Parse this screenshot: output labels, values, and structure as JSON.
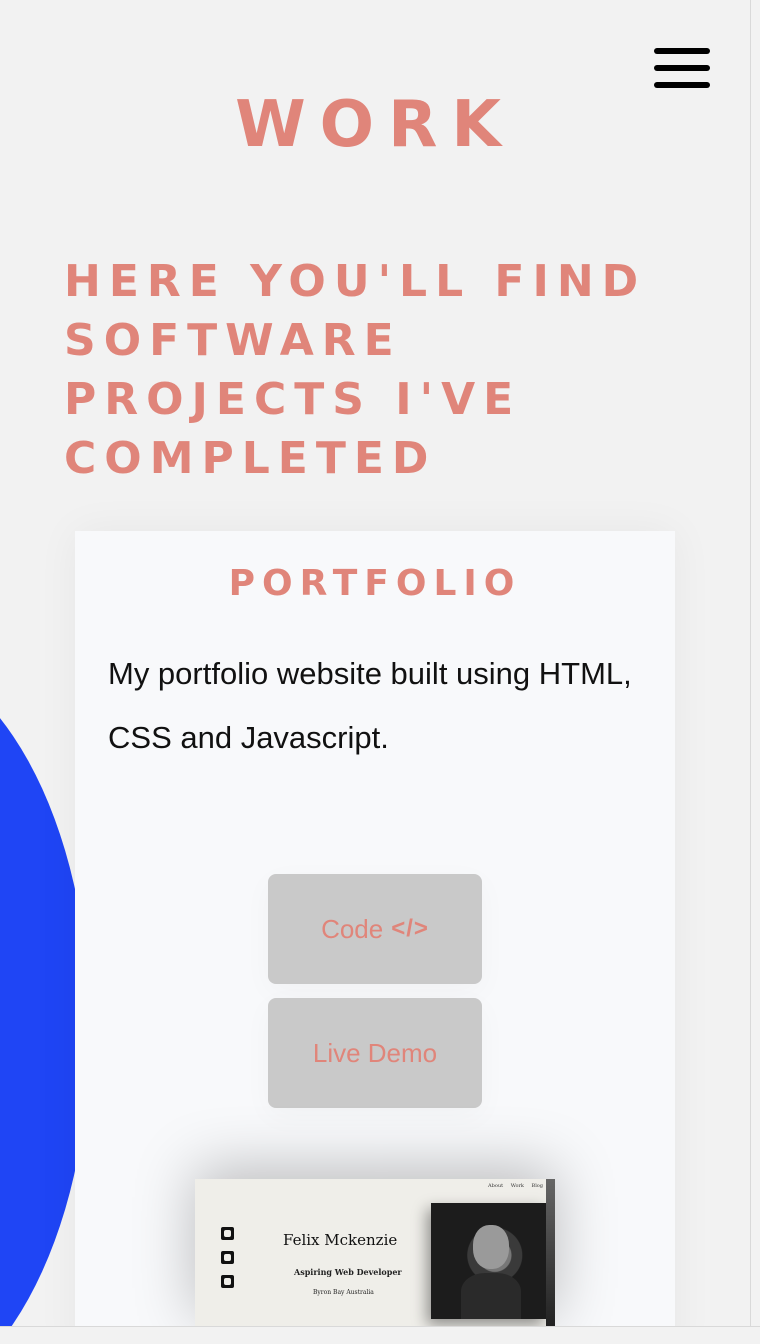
{
  "header": {
    "title": "WORK",
    "menu_icon": "hamburger-menu-icon"
  },
  "intro": {
    "text": "HERE YOU'LL FIND SOFTWARE PROJECTS I'VE COMPLETED"
  },
  "project": {
    "title": "PORTFOLIO",
    "description": "My portfolio website built using HTML, CSS and Javascript.",
    "code_button": "Code",
    "code_icon": "</>",
    "demo_button": "Live Demo",
    "preview": {
      "nav": [
        "About",
        "Work",
        "Blog"
      ],
      "social_icons": [
        "github-icon",
        "linkedin-icon",
        "twitter-icon"
      ],
      "name": "Felix Mckenzie",
      "role": "Aspiring Web Developer",
      "location": "Byron Bay Australia"
    }
  },
  "colors": {
    "accent": "#e0857a",
    "blob": "#1f45f5",
    "button_bg": "#c9c9c9",
    "background": "#f2f2f2"
  }
}
